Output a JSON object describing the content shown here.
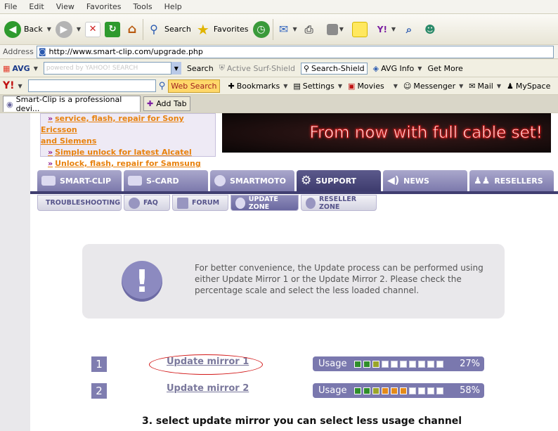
{
  "menu": [
    "File",
    "Edit",
    "View",
    "Favorites",
    "Tools",
    "Help"
  ],
  "toolbar": {
    "back": "Back",
    "search": "Search",
    "favorites": "Favorites"
  },
  "address": {
    "label": "Address",
    "url": "http://www.smart-clip.com/upgrade.php"
  },
  "avg": {
    "brand": "AVG",
    "search_placeholder": "powered by YAHOO! SEARCH",
    "search": "Search",
    "active_shield": "Active  Surf-Shield",
    "search_shield": "Search-Shield",
    "avg_info": "AVG Info",
    "get_more": "Get More"
  },
  "yahoo": {
    "web_search": "Web Search",
    "bookmarks": "Bookmarks",
    "settings": "Settings",
    "movies": "Movies",
    "messenger": "Messenger",
    "mail": "Mail",
    "myspace": "MySpace"
  },
  "tabs": {
    "current": "Smart-Clip is a professional devi...",
    "add": "Add Tab"
  },
  "news": [
    {
      "text": "service, flash, repair for Sony Ericsson"
    },
    {
      "text": "and Siemens"
    },
    {
      "text": "Simple unlock for latest Alcatel"
    },
    {
      "text": "Unlock, flash, repair for Samsung"
    }
  ],
  "banner": "From now with full cable set!",
  "main_tabs": [
    "SMART-CLIP",
    "S-CARD",
    "SMARTMOTO",
    "SUPPORT",
    "NEWS",
    "RESELLERS"
  ],
  "sub_tabs": [
    "TROUBLESHOOTING",
    "FAQ",
    "FORUM",
    "UPDATE ZONE",
    "RESELLER ZONE"
  ],
  "info": "For better convenience, the Update process can be performed using either Update Mirror 1 or the Update Mirror 2. Please check the percentage scale and select the less loaded channel.",
  "mirrors": [
    {
      "num": "1",
      "label": "Update mirror 1",
      "usage_label": "Usage",
      "usage": "27%",
      "usage_fraction": 0.27
    },
    {
      "num": "2",
      "label": "Update mirror 2",
      "usage_label": "Usage",
      "usage": "58%",
      "usage_fraction": 0.58
    }
  ],
  "caption": "3. select update mirror  you can select less usage channel"
}
